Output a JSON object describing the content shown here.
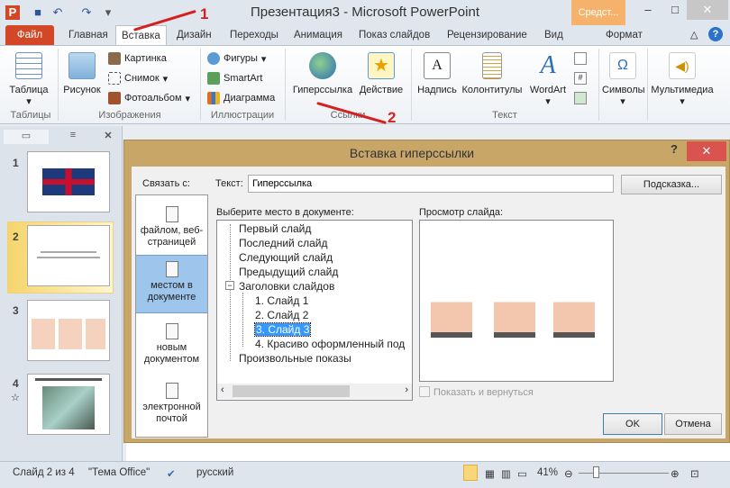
{
  "app_title": "Презентация3 - Microsoft PowerPoint",
  "context_tab": "Средст...",
  "tabs": [
    "Файл",
    "Главная",
    "Вставка",
    "Дизайн",
    "Переходы",
    "Анимация",
    "Показ слайдов",
    "Рецензирование",
    "Вид",
    "Формат"
  ],
  "ribbon": {
    "table": "Таблица",
    "picture": "Рисунок",
    "clipart": "Картинка",
    "screenshot": "Снимок",
    "album": "Фотоальбом",
    "shapes": "Фигуры",
    "smartart": "SmartArt",
    "chart": "Диаграмма",
    "hyperlink": "Гиперссылка",
    "action": "Действие",
    "textbox": "Надпись",
    "headerfooter": "Колонтитулы",
    "wordart": "WordArt",
    "symbols": "Символы",
    "media": "Мультимедиа",
    "groups": [
      "Таблицы",
      "Изображения",
      "Иллюстрации",
      "Ссылки",
      "Текст"
    ]
  },
  "annotations": [
    "1",
    "2"
  ],
  "slides": [
    "1",
    "2",
    "3",
    "4"
  ],
  "status": {
    "slide": "Слайд 2 из 4",
    "theme": "\"Тема Office\"",
    "lang": "русский",
    "zoom": "41%"
  },
  "dialog": {
    "title": "Вставка гиперссылки",
    "help": "?",
    "link_to": "Связать с:",
    "text_label": "Текст:",
    "text_value": "Гиперссылка",
    "tooltip_btn": "Подсказка...",
    "nav": [
      "файлом, веб-страницей",
      "местом в документе",
      "новым документом",
      "электронной почтой"
    ],
    "place_label": "Выберите место в документе:",
    "tree": [
      "Первый слайд",
      "Последний слайд",
      "Следующий слайд",
      "Предыдущий слайд",
      "Заголовки слайдов",
      "1. Слайд 1",
      "2. Слайд 2",
      "3. Слайд 3",
      "4. Красиво оформленный под",
      "Произвольные показы"
    ],
    "preview_label": "Просмотр слайда:",
    "show_return": "Показать и вернуться",
    "ok": "OK",
    "cancel": "Отмена"
  }
}
